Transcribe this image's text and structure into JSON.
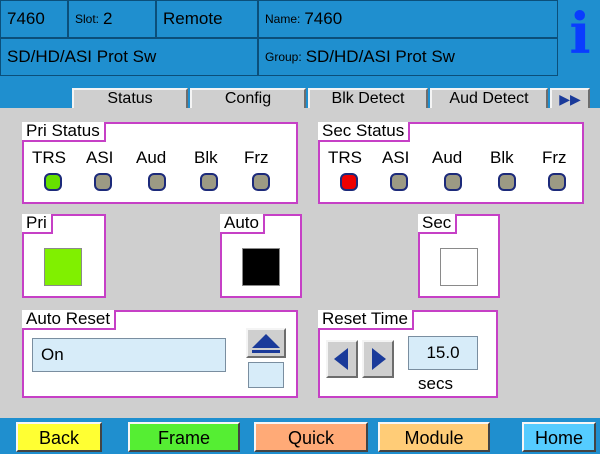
{
  "header": {
    "frame_id": "7460",
    "slot_label": "Slot:",
    "slot_value": "2",
    "mode": "Remote",
    "name_label": "Name:",
    "name_value": "7460",
    "description": "SD/HD/ASI Prot Sw",
    "group_label": "Group:",
    "group_value": "SD/HD/ASI Prot Sw",
    "info_icon": "i"
  },
  "tabs": [
    {
      "label": "Status"
    },
    {
      "label": "Config"
    },
    {
      "label": "Blk Detect"
    },
    {
      "label": "Aud Detect"
    }
  ],
  "tabs_more_icon": "▶▶",
  "pri_status": {
    "title": "Pri Status",
    "items": [
      {
        "label": "TRS",
        "color": "#66e000"
      },
      {
        "label": "ASI",
        "color": "#9c9a84"
      },
      {
        "label": "Aud",
        "color": "#9c9a84"
      },
      {
        "label": "Blk",
        "color": "#9c9a84"
      },
      {
        "label": "Frz",
        "color": "#9c9a84"
      }
    ]
  },
  "sec_status": {
    "title": "Sec Status",
    "items": [
      {
        "label": "TRS",
        "color": "#ee0000"
      },
      {
        "label": "ASI",
        "color": "#9c9a84"
      },
      {
        "label": "Aud",
        "color": "#9c9a84"
      },
      {
        "label": "Blk",
        "color": "#9c9a84"
      },
      {
        "label": "Frz",
        "color": "#9c9a84"
      }
    ]
  },
  "pri_select": {
    "title": "Pri",
    "color": "#80f000"
  },
  "auto_select": {
    "title": "Auto",
    "color": "#000000"
  },
  "sec_select": {
    "title": "Sec",
    "color": "#ffffff"
  },
  "auto_reset": {
    "title": "Auto Reset",
    "value": "On"
  },
  "reset_time": {
    "title": "Reset Time",
    "value": "15.0",
    "unit": "secs"
  },
  "nav": [
    {
      "label": "Back",
      "color": "#ffff33"
    },
    {
      "label": "Frame",
      "color": "#55ee33"
    },
    {
      "label": "Quick",
      "color": "#ffaa77"
    },
    {
      "label": "Module",
      "color": "#ffcc77"
    },
    {
      "label": "Home",
      "color": "#55ccff"
    }
  ],
  "colors": {
    "header_bg": "#1f8fcf",
    "panel_border": "#c640c6",
    "field_bg": "#d7ecf9",
    "arrow_color": "#1a3a9a"
  }
}
